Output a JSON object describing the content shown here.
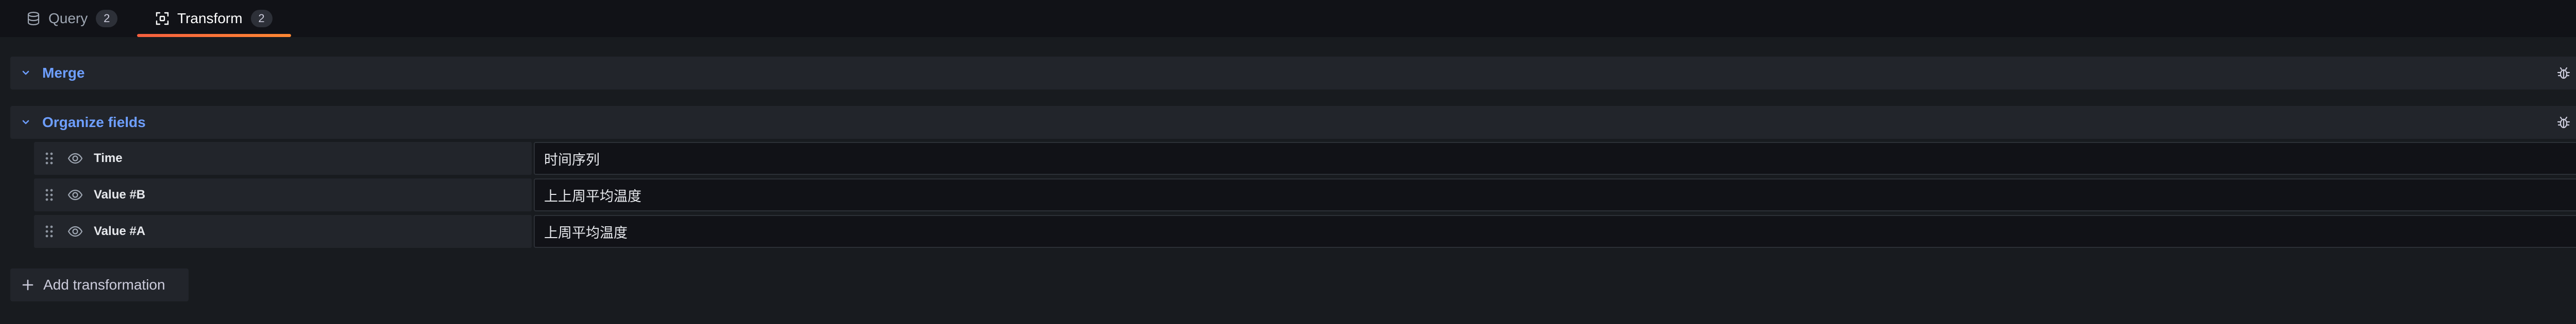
{
  "tabs": [
    {
      "label": "Query",
      "count": "2",
      "icon": "database-icon",
      "active": false
    },
    {
      "label": "Transform",
      "count": "2",
      "icon": "transform-icon",
      "active": true
    }
  ],
  "transformations": [
    {
      "title": "Merge",
      "expanded": false
    },
    {
      "title": "Organize fields",
      "expanded": true
    }
  ],
  "fields": [
    {
      "name": "Time",
      "rename": "时间序列"
    },
    {
      "name": "Value #B",
      "rename": "上上周平均温度"
    },
    {
      "name": "Value #A",
      "rename": "上周平均温度"
    }
  ],
  "add_transformation_label": "Add transformation",
  "colors": {
    "accent_link": "#6e9fff",
    "tab_underline_start": "#f55f3e",
    "tab_underline_end": "#ff8833",
    "background": "#181b1f",
    "row_background": "#22252b"
  }
}
